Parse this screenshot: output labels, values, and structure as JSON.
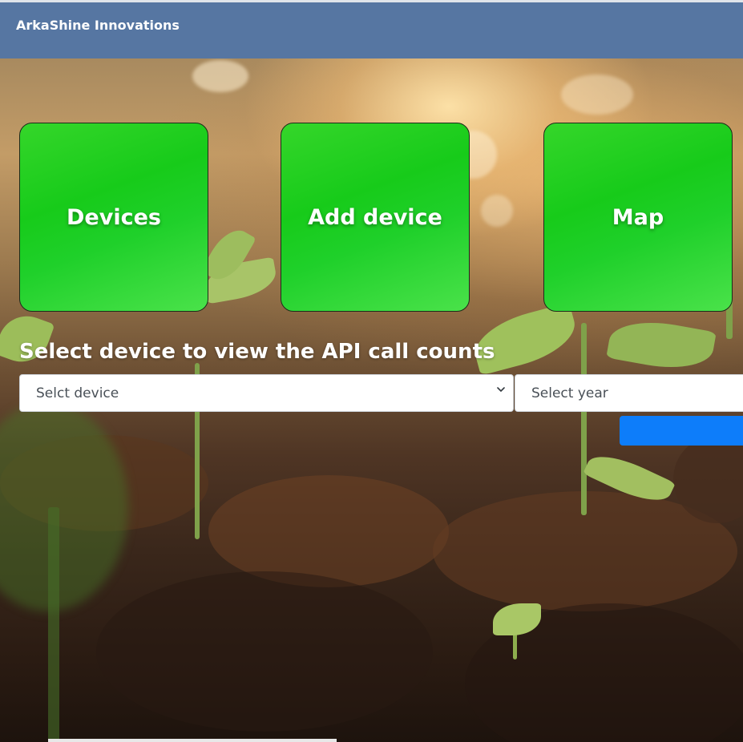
{
  "navbar": {
    "brand": "ArkaShine Innovations"
  },
  "tiles": [
    {
      "label": "Devices"
    },
    {
      "label": "Add device"
    },
    {
      "label": "Map"
    }
  ],
  "api_counts": {
    "heading": "Select device to view the API call counts",
    "device_select": {
      "selected": "Selct device"
    },
    "year_select": {
      "selected": "Select year"
    },
    "submit_label": ""
  },
  "colors": {
    "navbar": "#5676a2",
    "tile_green": "#1ccb1f",
    "button_blue": "#0d7dfa"
  }
}
